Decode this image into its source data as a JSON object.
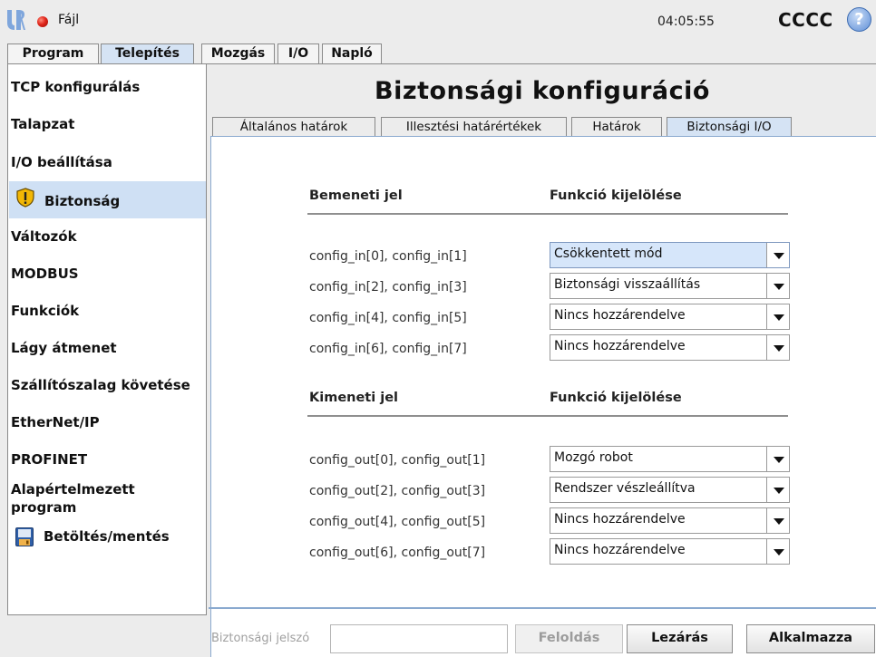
{
  "topbar": {
    "file_label": "Fájl",
    "clock": "04:05:55",
    "robot_name": "CCCC",
    "help_glyph": "?"
  },
  "tabs": [
    {
      "label": "Program",
      "active": false
    },
    {
      "label": "Telepítés",
      "active": true
    },
    {
      "label": "Mozgás",
      "active": false
    },
    {
      "label": "I/O",
      "active": false
    },
    {
      "label": "Napló",
      "active": false
    }
  ],
  "sidebar": {
    "items": [
      {
        "label": "TCP konfigurálás"
      },
      {
        "label": "Talapzat"
      },
      {
        "label": "I/O beállítása"
      },
      {
        "label": "Biztonság",
        "icon": "shield-warning-icon",
        "selected": true
      },
      {
        "label": "Változók"
      },
      {
        "label": "MODBUS"
      },
      {
        "label": "Funkciók"
      },
      {
        "label": "Lágy átmenet"
      },
      {
        "label": "Szállítószalag követése"
      },
      {
        "label": "EtherNet/IP"
      },
      {
        "label": "PROFINET"
      },
      {
        "label": "Alapértelmezett program"
      },
      {
        "label": "Betöltés/mentés",
        "icon": "floppy-disk-icon"
      }
    ]
  },
  "main": {
    "title": "Biztonsági konfiguráció",
    "subtabs": [
      {
        "label": "Általános határok"
      },
      {
        "label": "Illesztési határértékek"
      },
      {
        "label": "Határok"
      },
      {
        "label": "Biztonsági I/O",
        "active": true
      }
    ],
    "inputs": {
      "header_signal": "Bemeneti jel",
      "header_function": "Funkció kijelölése",
      "rows": [
        {
          "signal": "config_in[0], config_in[1]",
          "function": "Csökkentett mód"
        },
        {
          "signal": "config_in[2], config_in[3]",
          "function": "Biztonsági visszaállítás"
        },
        {
          "signal": "config_in[4], config_in[5]",
          "function": "Nincs hozzárendelve"
        },
        {
          "signal": "config_in[6], config_in[7]",
          "function": "Nincs hozzárendelve"
        }
      ]
    },
    "outputs": {
      "header_signal": "Kimeneti jel",
      "header_function": "Funkció kijelölése",
      "rows": [
        {
          "signal": "config_out[0], config_out[1]",
          "function": "Mozgó robot"
        },
        {
          "signal": "config_out[2], config_out[3]",
          "function": "Rendszer vészleállítva"
        },
        {
          "signal": "config_out[4], config_out[5]",
          "function": "Nincs hozzárendelve"
        },
        {
          "signal": "config_out[6], config_out[7]",
          "function": "Nincs hozzárendelve"
        }
      ]
    }
  },
  "bottom": {
    "password_label": "Biztonsági jelszó",
    "password_value": "",
    "unlock_label": "Feloldás",
    "lock_label": "Lezárás",
    "apply_label": "Alkalmazza"
  },
  "colors": {
    "accent": "#cfe0f4",
    "record": "#e0261b",
    "help": "#5f8fd6"
  }
}
